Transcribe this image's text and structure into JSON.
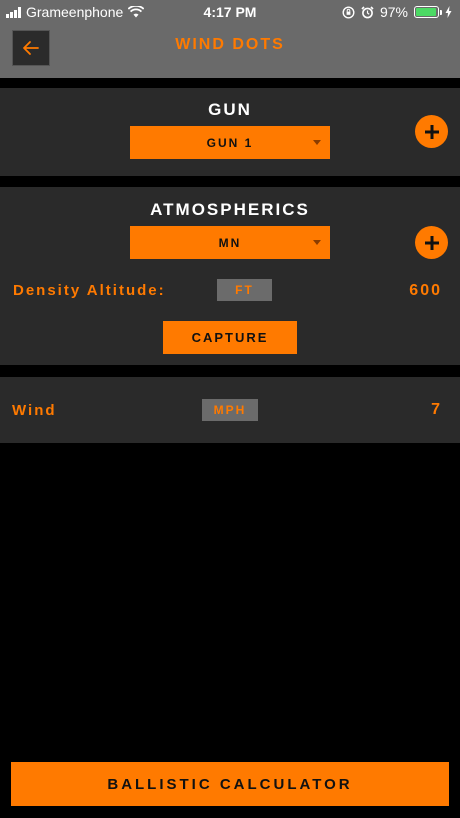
{
  "status_bar": {
    "carrier": "Grameenphone",
    "time": "4:17 PM",
    "battery_percent": "97%",
    "battery_level": 0.97
  },
  "header": {
    "title": "WIND DOTS",
    "back_icon": "arrow-left-icon"
  },
  "gun_section": {
    "title": "GUN",
    "selected": "GUN 1",
    "add_icon": "plus-icon"
  },
  "atmospherics_section": {
    "title": "ATMOSPHERICS",
    "selected": "MN",
    "add_icon": "plus-icon",
    "density_altitude_label": "Density Altitude:",
    "density_altitude_unit": "FT",
    "density_altitude_value": "600",
    "capture_label": "CAPTURE"
  },
  "wind_section": {
    "label": "Wind",
    "unit": "MPH",
    "value": "7"
  },
  "footer": {
    "calculator_label": "BALLISTIC CALCULATOR"
  },
  "colors": {
    "accent": "#ff7a00",
    "panel": "#2a2a2a",
    "header": "#6a6a6a",
    "background": "#000000"
  }
}
